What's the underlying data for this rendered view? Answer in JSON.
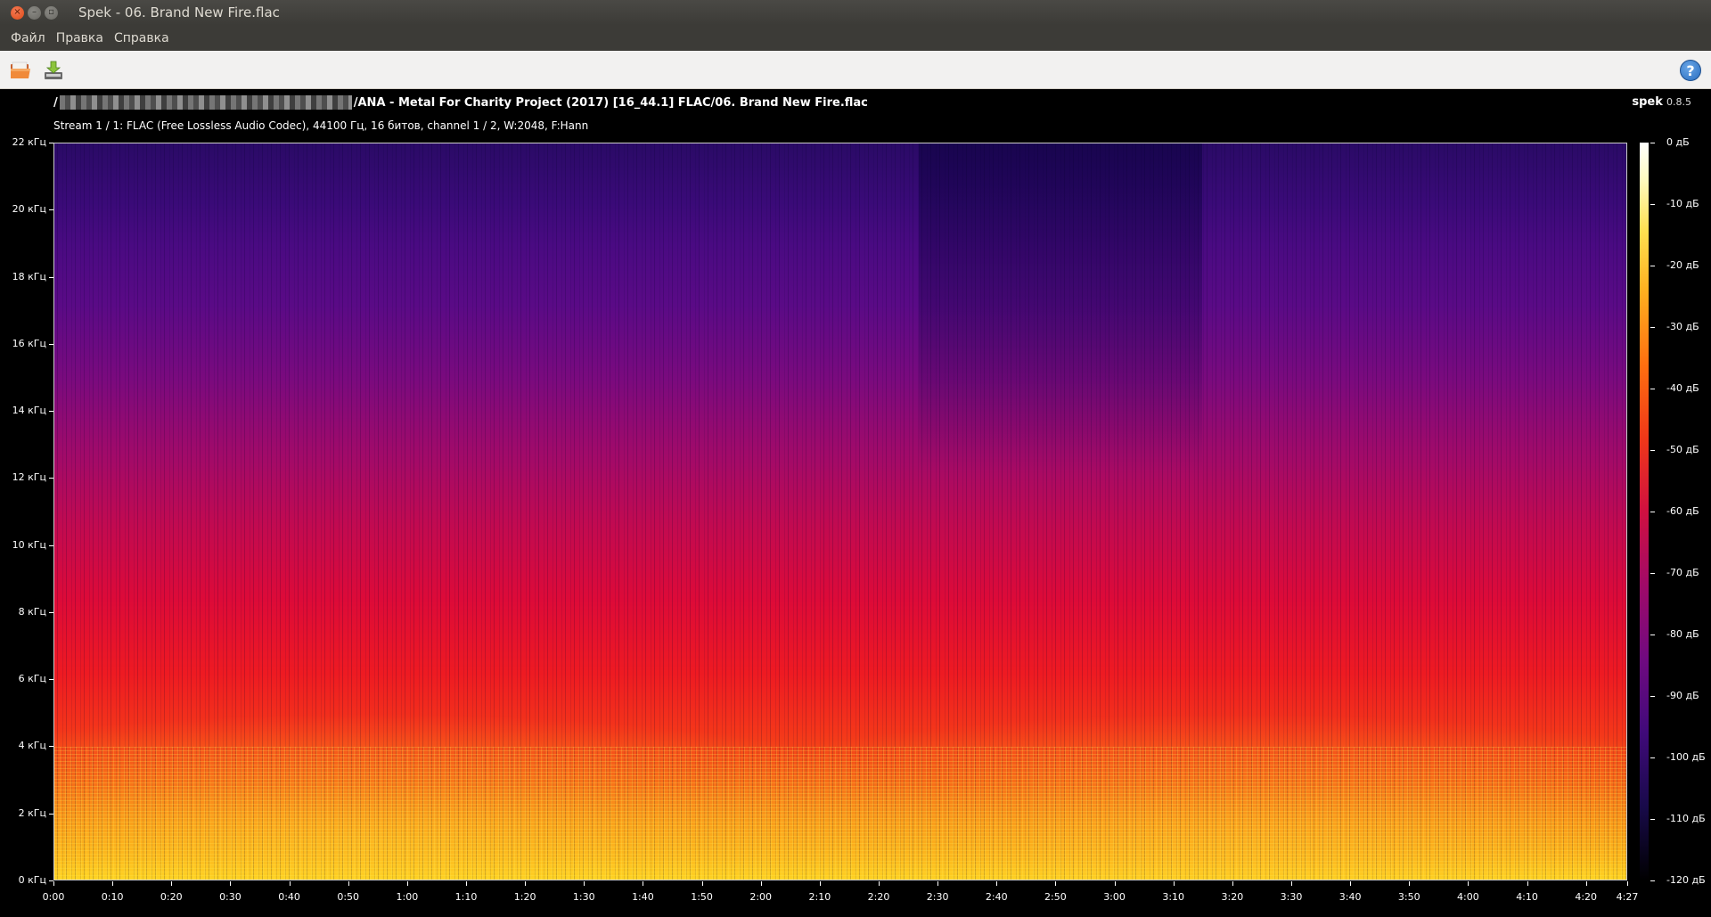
{
  "window": {
    "title": "Spek - 06. Brand New Fire.flac"
  },
  "menu": {
    "items": [
      "Файл",
      "Правка",
      "Справка"
    ]
  },
  "toolbar": {
    "open_icon": "folder-open-icon",
    "save_icon": "save-download-icon",
    "help_icon": "help-icon",
    "help_glyph": "?"
  },
  "header": {
    "path_prefix": "/",
    "path_suffix": "/ANA - Metal For Charity Project (2017) [16_44.1] FLAC/06. Brand New Fire.flac",
    "stream_info": "Stream 1 / 1: FLAC (Free Lossless Audio Codec), 44100 Гц, 16 битов, channel 1 / 2, W:2048, F:Hann",
    "brand_name": "spek",
    "brand_version": "0.8.5"
  },
  "chart_data": {
    "type": "heatmap",
    "title": "",
    "y_tick_labels": [
      "22 кГц",
      "20 кГц",
      "18 кГц",
      "16 кГц",
      "14 кГц",
      "12 кГц",
      "10 кГц",
      "8 кГц",
      "6 кГц",
      "4 кГц",
      "2 кГц",
      "0 кГц"
    ],
    "y_values_khz": [
      22,
      20,
      18,
      16,
      14,
      12,
      10,
      8,
      6,
      4,
      2,
      0
    ],
    "ylim_khz": [
      0,
      22
    ],
    "x_tick_labels": [
      "0:00",
      "0:10",
      "0:20",
      "0:30",
      "0:40",
      "0:50",
      "1:00",
      "1:10",
      "1:20",
      "1:30",
      "1:40",
      "1:50",
      "2:00",
      "2:10",
      "2:20",
      "2:30",
      "2:40",
      "2:50",
      "3:00",
      "3:10",
      "3:20",
      "3:30",
      "3:40",
      "3:50",
      "4:00",
      "4:10",
      "4:20",
      "4:27"
    ],
    "x_values_sec": [
      0,
      10,
      20,
      30,
      40,
      50,
      60,
      70,
      80,
      90,
      100,
      110,
      120,
      130,
      140,
      150,
      160,
      170,
      180,
      190,
      200,
      210,
      220,
      230,
      240,
      250,
      260,
      267
    ],
    "xlim_sec": [
      0,
      267
    ],
    "colorbar_labels": [
      "0 дБ",
      "-10 дБ",
      "-20 дБ",
      "-30 дБ",
      "-40 дБ",
      "-50 дБ",
      "-60 дБ",
      "-70 дБ",
      "-80 дБ",
      "-90 дБ",
      "-100 дБ",
      "-110 дБ",
      "-120 дБ"
    ],
    "colorbar_values_db": [
      0,
      -10,
      -20,
      -30,
      -40,
      -50,
      -60,
      -70,
      -80,
      -90,
      -100,
      -110,
      -120
    ],
    "colorbar_range_db": [
      -120,
      0
    ]
  }
}
